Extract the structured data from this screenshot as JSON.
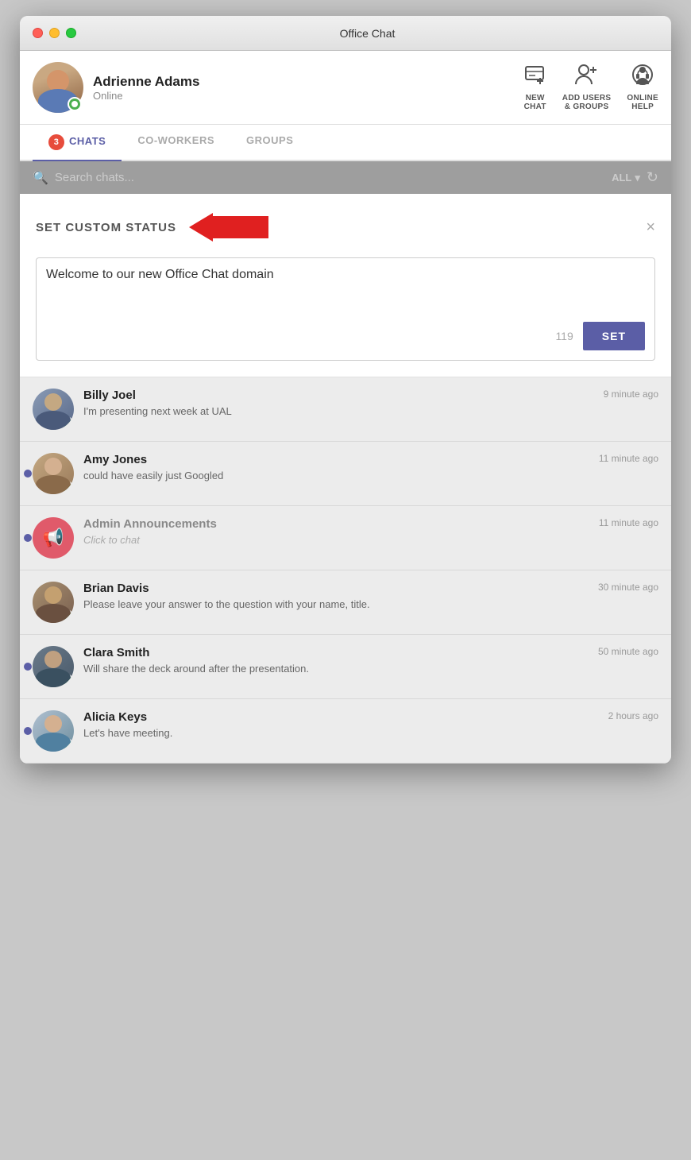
{
  "window": {
    "title": "Office Chat"
  },
  "header": {
    "user_name": "Adrienne Adams",
    "user_status": "Online",
    "actions": [
      {
        "id": "new-chat",
        "line1": "NEW",
        "line2": "CHAT"
      },
      {
        "id": "add-users",
        "line1": "ADD USERS",
        "line2": "& GROUPS"
      },
      {
        "id": "online-help",
        "line1": "ONLINE",
        "line2": "HELP"
      }
    ]
  },
  "tabs": [
    {
      "id": "chats",
      "label": "CHATS",
      "active": true,
      "badge": 3
    },
    {
      "id": "coworkers",
      "label": "CO-WORKERS",
      "active": false
    },
    {
      "id": "groups",
      "label": "GROUPS",
      "active": false
    }
  ],
  "search": {
    "placeholder": "Search chats...",
    "filter_label": "ALL",
    "value": ""
  },
  "custom_status": {
    "title": "SET CUSTOM STATUS",
    "text": "Welcome to our new Office Chat domain",
    "char_count": "119",
    "set_button": "SET",
    "close_label": "×"
  },
  "chats": [
    {
      "id": "billy-joel",
      "name": "Billy Joel",
      "message": "I'm presenting next week at UAL",
      "time": "9 minute ago",
      "online": true,
      "unread": false,
      "avatar_type": "person"
    },
    {
      "id": "amy-jones",
      "name": "Amy Jones",
      "message": "could have easily just Googled",
      "time": "11 minute ago",
      "online": true,
      "unread": true,
      "avatar_type": "person"
    },
    {
      "id": "admin-announcements",
      "name": "Admin Announcements",
      "message": "Click to chat",
      "time": "11 minute ago",
      "online": false,
      "unread": true,
      "avatar_type": "admin",
      "italic": true
    },
    {
      "id": "brian-davis",
      "name": "Brian Davis",
      "message": "Please leave your answer to the question with your name, title.",
      "time": "30 minute ago",
      "online": true,
      "unread": false,
      "avatar_type": "person"
    },
    {
      "id": "clara-smith",
      "name": "Clara Smith",
      "message": "Will share the deck around after the presentation.",
      "time": "50 minute ago",
      "online": true,
      "unread": true,
      "avatar_type": "person"
    },
    {
      "id": "alicia-keys",
      "name": "Alicia Keys",
      "message": "Let's have meeting.",
      "time": "2 hours ago",
      "online": true,
      "unread": true,
      "avatar_type": "person"
    }
  ]
}
